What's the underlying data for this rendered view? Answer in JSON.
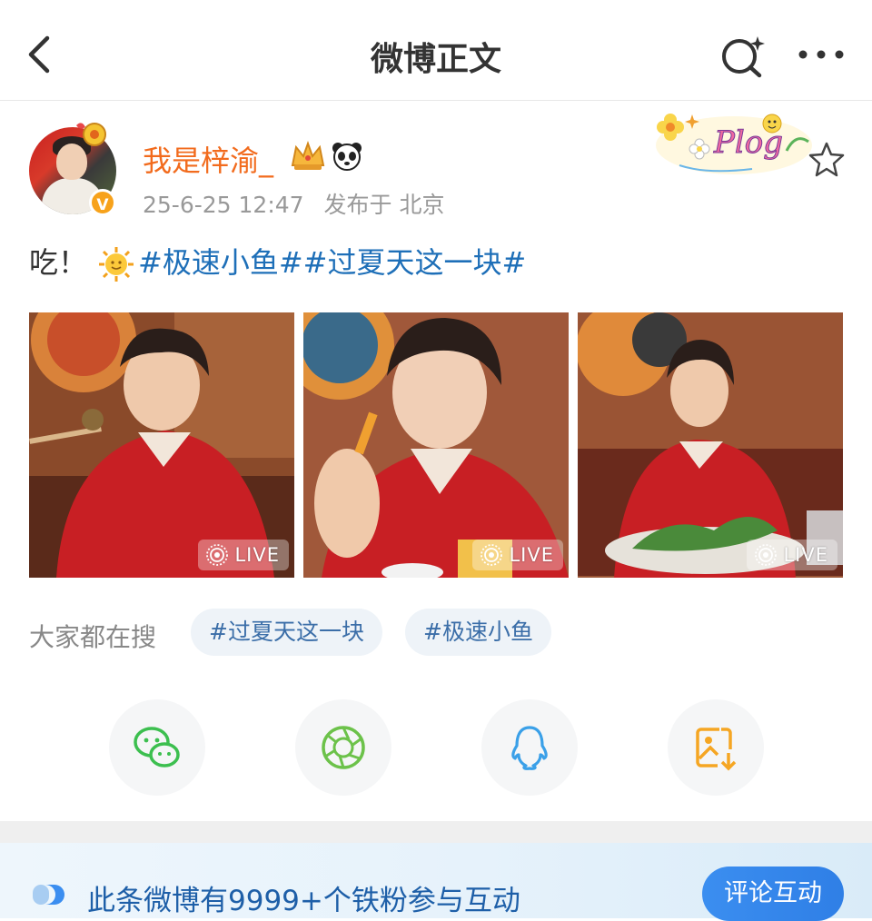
{
  "header": {
    "title": "微博正文",
    "back_icon": "chevron-left-icon",
    "search_icon": "search-sparkle-icon",
    "more_icon": "more-dots-icon"
  },
  "post": {
    "username": "我是梓渝_",
    "verified_badge": "V",
    "time": "25-6-25 12:47",
    "location": "发布于 北京",
    "text_prefix": "吃！",
    "hashtags": [
      "#极速小鱼#",
      "#过夏天这一块#"
    ],
    "photos": [
      {
        "live_label": "LIVE"
      },
      {
        "live_label": "LIVE"
      },
      {
        "live_label": "LIVE"
      }
    ],
    "sticker_text": "Plog"
  },
  "search": {
    "label": "大家都在搜",
    "tags": [
      "#过夏天这一块",
      "#极速小鱼"
    ]
  },
  "share": [
    {
      "name": "wechat",
      "icon": "wechat-icon"
    },
    {
      "name": "moments",
      "icon": "moments-icon"
    },
    {
      "name": "qq",
      "icon": "qq-icon"
    },
    {
      "name": "save-image",
      "icon": "save-image-icon"
    }
  ],
  "banner": {
    "text": "此条微博有9999+个铁粉参与互动",
    "button": "评论互动"
  },
  "colors": {
    "username": "#f26b1d",
    "hashtag": "#1e6fb8",
    "accent_blue": "#2f7fe6",
    "wechat_green": "#3cbf4f",
    "moments_green": "#6cc24a",
    "qq_blue": "#3aa0e8",
    "save_orange": "#f5a623"
  }
}
